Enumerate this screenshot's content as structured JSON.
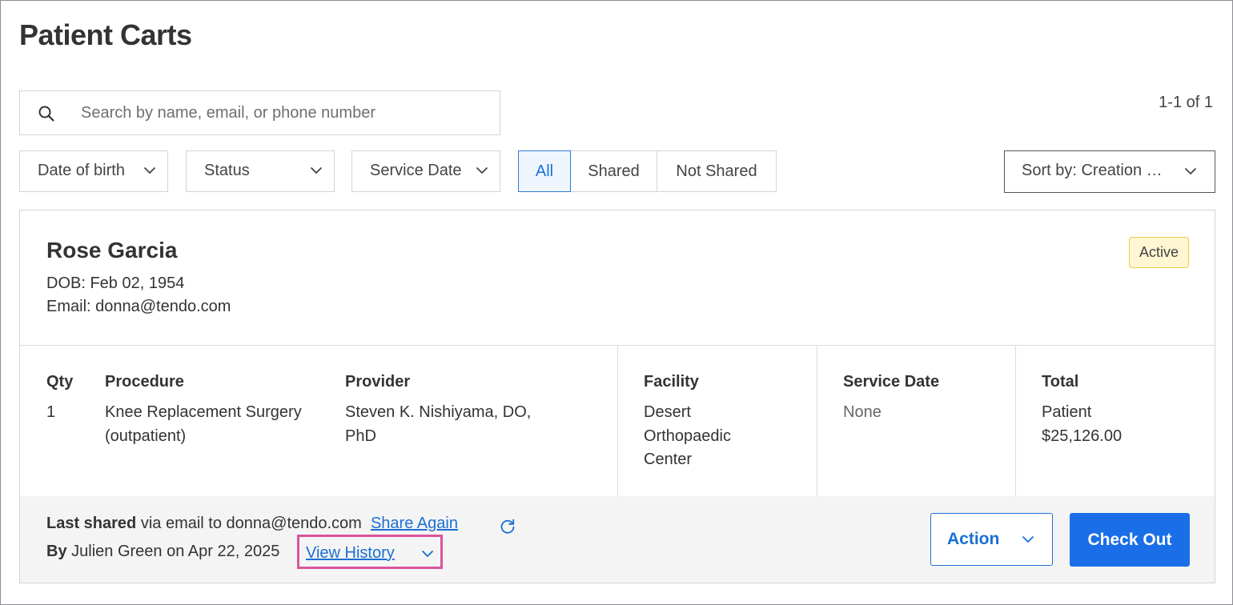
{
  "page": {
    "title": "Patient Carts"
  },
  "search": {
    "placeholder": "Search by name, email, or phone number",
    "value": ""
  },
  "pagination": {
    "text": "1-1 of 1"
  },
  "filters": {
    "date_of_birth": "Date of birth",
    "status": "Status",
    "service_date": "Service Date"
  },
  "share_filter": {
    "options": [
      "All",
      "Shared",
      "Not Shared"
    ],
    "selected": "All"
  },
  "sort": {
    "label": "Sort by: Creation …"
  },
  "cart": {
    "patient_name": "Rose Garcia",
    "dob": "DOB: Feb 02, 1954",
    "email": "Email: donna@tendo.com",
    "status": "Active",
    "columns": {
      "qty": {
        "header": "Qty",
        "value": "1"
      },
      "procedure": {
        "header": "Procedure",
        "value_line1": "Knee Replacement Surgery",
        "value_line2": "(outpatient)"
      },
      "provider": {
        "header": "Provider",
        "value_line1": "Steven K. Nishiyama, DO,",
        "value_line2": "PhD"
      },
      "facility": {
        "header": "Facility",
        "value_line1": "Desert",
        "value_line2": "Orthopaedic",
        "value_line3": "Center"
      },
      "service_date": {
        "header": "Service Date",
        "value": "None"
      },
      "total": {
        "header": "Total",
        "value_line1": "Patient",
        "value_line2": "$25,126.00"
      }
    },
    "footer": {
      "last_shared_bold": "Last shared",
      "last_shared_text": " via email to donna@tendo.com",
      "share_again": "Share Again",
      "by_bold": "By",
      "by_text": " Julien Green on Apr 22, 2025",
      "view_history": "View History",
      "action_label": "Action",
      "checkout_label": "Check Out"
    }
  },
  "colors": {
    "accent": "#1a6fd4",
    "checkout_bg": "#1a6fe8",
    "badge_bg": "#fff6d4",
    "badge_border": "#f0c84a",
    "highlight": "#d9559c"
  },
  "icons": {
    "search": "search-icon",
    "chevron": "chevron-down-icon",
    "refresh": "refresh-icon"
  }
}
